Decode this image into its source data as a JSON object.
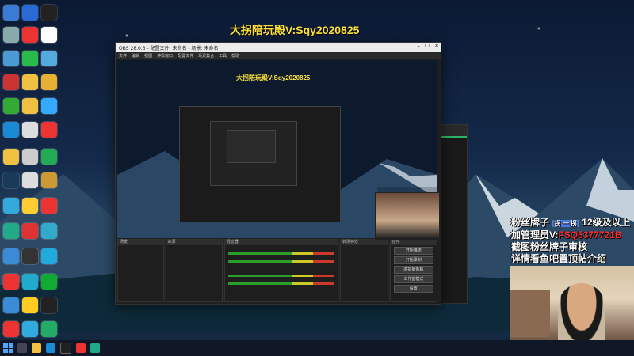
{
  "banner": {
    "text": "大拐陪玩殿V:Sqy2020825"
  },
  "obs": {
    "title": "OBS 28.0.3 - 配置文件: 未命名 - 场景: 未命名",
    "menu": [
      "文件",
      "编辑",
      "视图",
      "停靠窗口",
      "配置文件",
      "场景集合",
      "工具",
      "帮助"
    ],
    "preview_banner": "大拐陪玩殿V:Sqy2020825",
    "docks": {
      "scenes_label": "场景",
      "sources_label": "来源",
      "mixer_label": "混音器",
      "transitions_label": "转场特效",
      "controls_label": "控件",
      "control_buttons": [
        "开始推流",
        "开始录制",
        "虚拟摄像机",
        "工作室模式",
        "设置",
        "退出"
      ]
    }
  },
  "fan_overlay": {
    "line1_prefix": "粉丝牌子",
    "line1_badge": "拐 一 拐",
    "line1_suffix": "12级及以上",
    "line2_prefix": "加管理员V:",
    "line2_red": "FSQ5377721B",
    "line3": "截图粉丝牌子审核",
    "line4": "详情看鱼吧置顶帖介绍"
  },
  "colors": {
    "banner_yellow": "#ffe23a",
    "fan_red": "#ff2a2a",
    "obs_bg": "#1f1f1f",
    "taskbar": "#101828"
  }
}
